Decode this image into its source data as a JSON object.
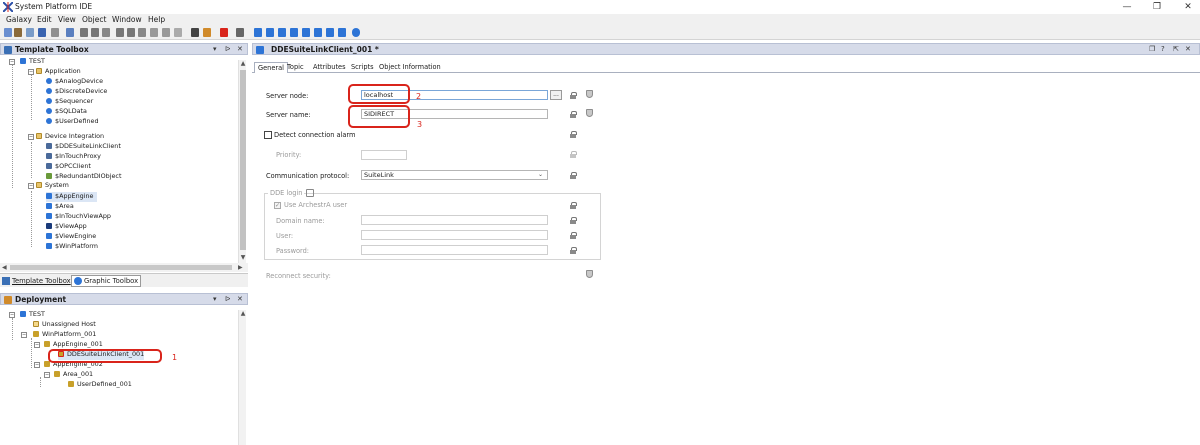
{
  "app": {
    "title": "System Platform IDE"
  },
  "window_controls": {
    "minimize": "—",
    "restore": "❐",
    "close": "✕"
  },
  "menu": [
    "Galaxy",
    "Edit",
    "View",
    "Object",
    "Window",
    "Help"
  ],
  "template_toolbox": {
    "title": "Template Toolbox",
    "controls": {
      "pin": "▾",
      "dock": "ᐅ",
      "close": "✕"
    },
    "root": "TEST",
    "groups": [
      {
        "name": "Application",
        "items": [
          "$AnalogDevice",
          "$DiscreteDevice",
          "$Sequencer",
          "$SQLData",
          "$UserDefined"
        ]
      },
      {
        "name": "Device Integration",
        "items": [
          "$DDESuiteLinkClient",
          "$InTouchProxy",
          "$OPCClient",
          "$RedundantDIObject"
        ]
      },
      {
        "name": "System",
        "items": [
          "$AppEngine",
          "$Area",
          "$InTouchViewApp",
          "$ViewApp",
          "$ViewEngine",
          "$WinPlatform"
        ]
      }
    ],
    "bottom_tabs": [
      "Template Toolbox",
      "Graphic Toolbox"
    ]
  },
  "deployment": {
    "title": "Deployment",
    "controls": {
      "pin": "▾",
      "dock": "ᐅ",
      "close": "✕"
    },
    "items": {
      "root": "TEST",
      "unassigned": "Unassigned Host",
      "platform": "WinPlatform_001",
      "engine1": "AppEngine_001",
      "client": "DDESuiteLinkClient_001",
      "engine2": "AppEngine_002",
      "area": "Area_001",
      "user_defined": "UserDefined_001"
    }
  },
  "editor": {
    "title": "DDESuiteLinkClient_001 *",
    "controls": {
      "restore": "❐",
      "help": "?",
      "dock": "⇱",
      "close": "✕"
    },
    "tabs": [
      "General",
      "Topic",
      "Attributes",
      "Scripts",
      "Object Information"
    ],
    "form": {
      "server_node_label": "Server node:",
      "server_node_value": "localhost",
      "browse_button": "...",
      "server_name_label": "Server name:",
      "server_name_value": "SIDIRECT",
      "detect_alarm_label": "Detect connection alarm",
      "priority_label": "Priority:",
      "protocol_label": "Communication protocol:",
      "protocol_value": "SuiteLink",
      "dde_login_label": "DDE login",
      "use_archestra_label": "Use ArchestrA user",
      "domain_label": "Domain name:",
      "user_label": "User:",
      "password_label": "Password:",
      "reconnect_label": "Reconnect security:"
    }
  },
  "annotations": [
    "1",
    "2",
    "3"
  ],
  "colors": {
    "accent_red": "#d9241b",
    "pane_header": "#d6dbe9",
    "blue_icon": "#2d74d6"
  }
}
